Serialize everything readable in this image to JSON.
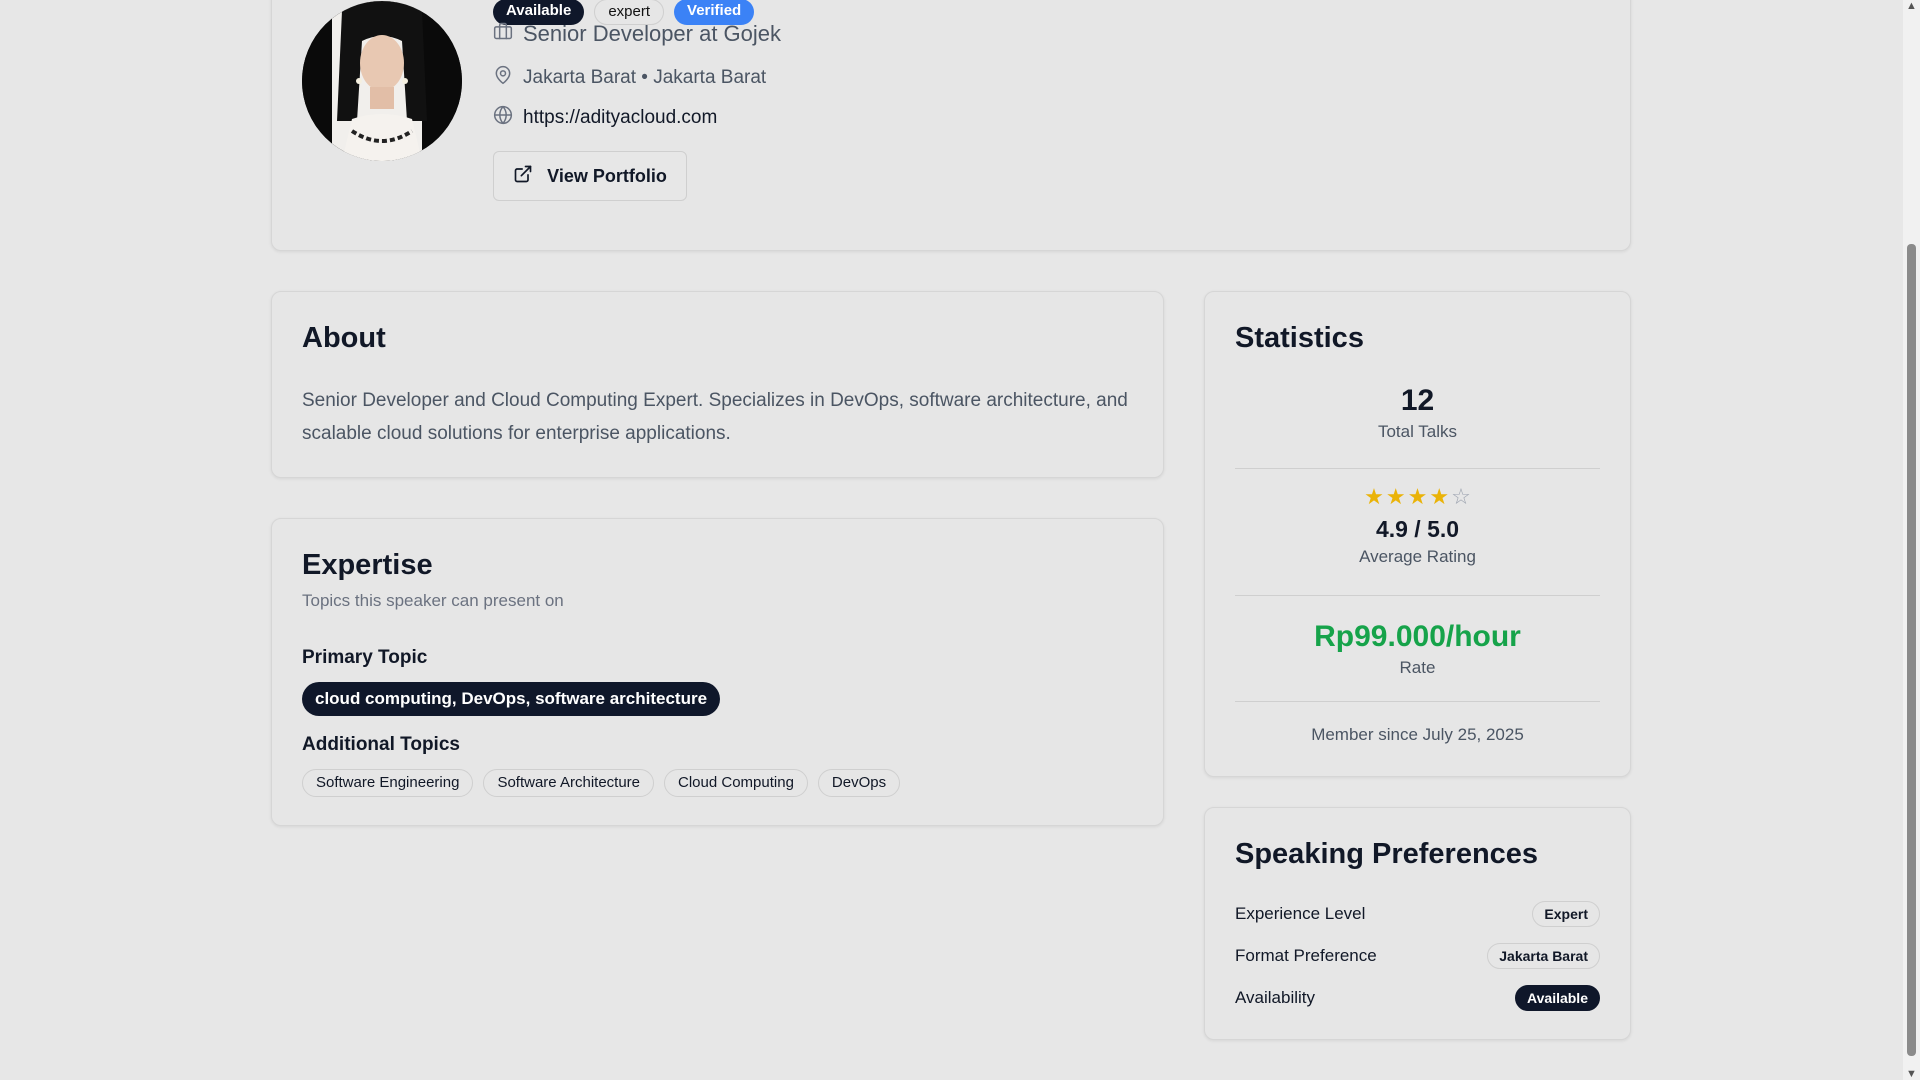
{
  "profile": {
    "badges": [
      "Available",
      "expert",
      "Verified"
    ],
    "company": "Senior Developer at Gojek",
    "location": "Jakarta Barat • Jakarta Barat",
    "website": "https://adityacloud.com",
    "portfolio_label": "View Portfolio"
  },
  "about": {
    "title": "About",
    "text": "Senior Developer and Cloud Computing Expert. Specializes in DevOps, software architecture, and scalable cloud solutions for enterprise applications."
  },
  "expertise": {
    "title": "Expertise",
    "subtitle": "Topics this speaker can present on",
    "primary_label": "Primary Topic",
    "primary_topic": "cloud computing, DevOps, software architecture",
    "additional_label": "Additional Topics",
    "additional_topics": [
      "Software Engineering",
      "Software Architecture",
      "Cloud Computing",
      "DevOps"
    ]
  },
  "statistics": {
    "title": "Statistics",
    "talks_value": "12",
    "talks_label": "Total Talks",
    "rating_stars": 4,
    "rating_value": "4.9 / 5.0",
    "rating_label": "Average Rating",
    "rate_value": "Rp99.000/hour",
    "rate_label": "Rate",
    "member_since": "Member since July 25, 2025"
  },
  "preferences": {
    "title": "Speaking Preferences",
    "rows": [
      {
        "label": "Experience Level",
        "value": "Expert"
      },
      {
        "label": "Format Preference",
        "value": "Jakarta Barat"
      },
      {
        "label": "Availability",
        "value": "Available"
      }
    ]
  },
  "colors": {
    "accent_dark": "#0f172a",
    "verified_blue": "#3b82f6",
    "rate_green": "#16a34a",
    "star_gold": "#eab308"
  },
  "icons": [
    "building-icon",
    "map-pin-icon",
    "globe-icon",
    "external-link-icon",
    "star-icon"
  ]
}
